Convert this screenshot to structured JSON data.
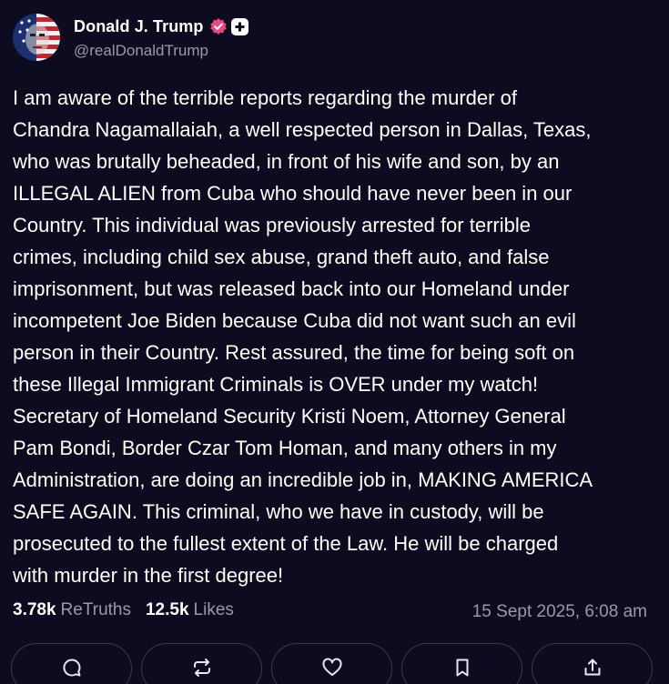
{
  "author": {
    "display_name": "Donald J. Trump",
    "handle": "@realDonaldTrump",
    "verified_color": "#e6497f"
  },
  "post": {
    "text": "I am aware of the terrible reports regarding the murder of\nChandra Nagamallaiah, a well respected person in Dallas, Texas,\nwho was brutally beheaded, in front of his wife and son, by an\nILLEGAL ALIEN from Cuba who should have never been in our\nCountry. This individual was previously arrested for terrible\ncrimes, including child sex abuse, grand theft auto, and false\nimprisonment, but was released back into our Homeland under\nincompetent Joe Biden because Cuba did not want such an evil\nperson in their Country. Rest assured, the time for being soft on\nthese Illegal Immigrant Criminals is OVER under my watch!\nSecretary of Homeland Security Kristi Noem, Attorney General\nPam Bondi, Border Czar Tom Homan, and many others in my\nAdministration, are doing an incredible job in, MAKING AMERICA\nSAFE AGAIN. This criminal, who we have in custody, will be\nprosecuted to the fullest extent of the Law. He will be charged\nwith murder in the first degree!",
    "retruths_count": "3.78k",
    "retruths_label": "ReTruths",
    "likes_count": "12.5k",
    "likes_label": "Likes",
    "timestamp": "15 Sept 2025, 6:08 am"
  },
  "actions": [
    {
      "icon": "comment-icon"
    },
    {
      "icon": "retruth-icon"
    },
    {
      "icon": "heart-icon"
    },
    {
      "icon": "bookmark-icon"
    },
    {
      "icon": "share-icon"
    }
  ],
  "colors": {
    "background": "#0c0b1f",
    "muted_text": "#9a98ad",
    "button_border": "#3b3a55"
  }
}
